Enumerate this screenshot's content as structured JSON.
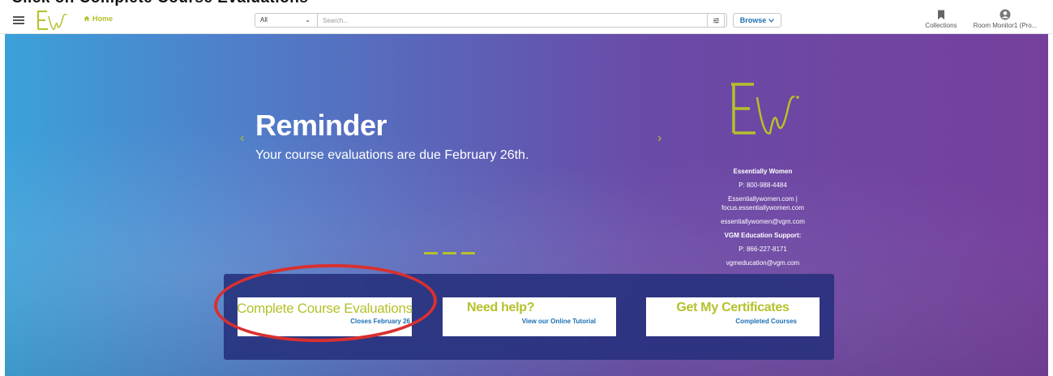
{
  "page": {
    "clipped_heading": "Click on Complete Course Evaluations"
  },
  "nav": {
    "home_label": "Home",
    "scope_value": "All",
    "search_placeholder": "Search...",
    "browse_label": "Browse",
    "collections_label": "Collections",
    "profile_label": "Room Monitor1 (Pro..."
  },
  "hero": {
    "title": "Reminder",
    "subtitle": "Your course evaluations are due February 26th.",
    "prev_arrow": "‹",
    "next_arrow": "›"
  },
  "contact": {
    "org": "Essentially Women",
    "phone": "P: 800-988-4484",
    "sites_line1": "Essentiallywomen.com |",
    "sites_line2": "focus.essentiallywomen.com",
    "email": "essentiallywomen@vgm.com",
    "support_title": "VGM Education Support:",
    "support_phone": "P: 866-227-8171",
    "support_email": "vgmeducation@vgm.com"
  },
  "ctas": [
    {
      "title": "Complete Course Evaluations",
      "subtitle": "Closes February 26"
    },
    {
      "title": "Need help?",
      "subtitle": "View our Online Tutorial"
    },
    {
      "title": "Get My Certificates",
      "subtitle": "Completed Courses"
    }
  ],
  "colors": {
    "brand_green": "#b5c12a",
    "link_blue": "#1a6fb5",
    "highlight_red": "#d93030"
  }
}
